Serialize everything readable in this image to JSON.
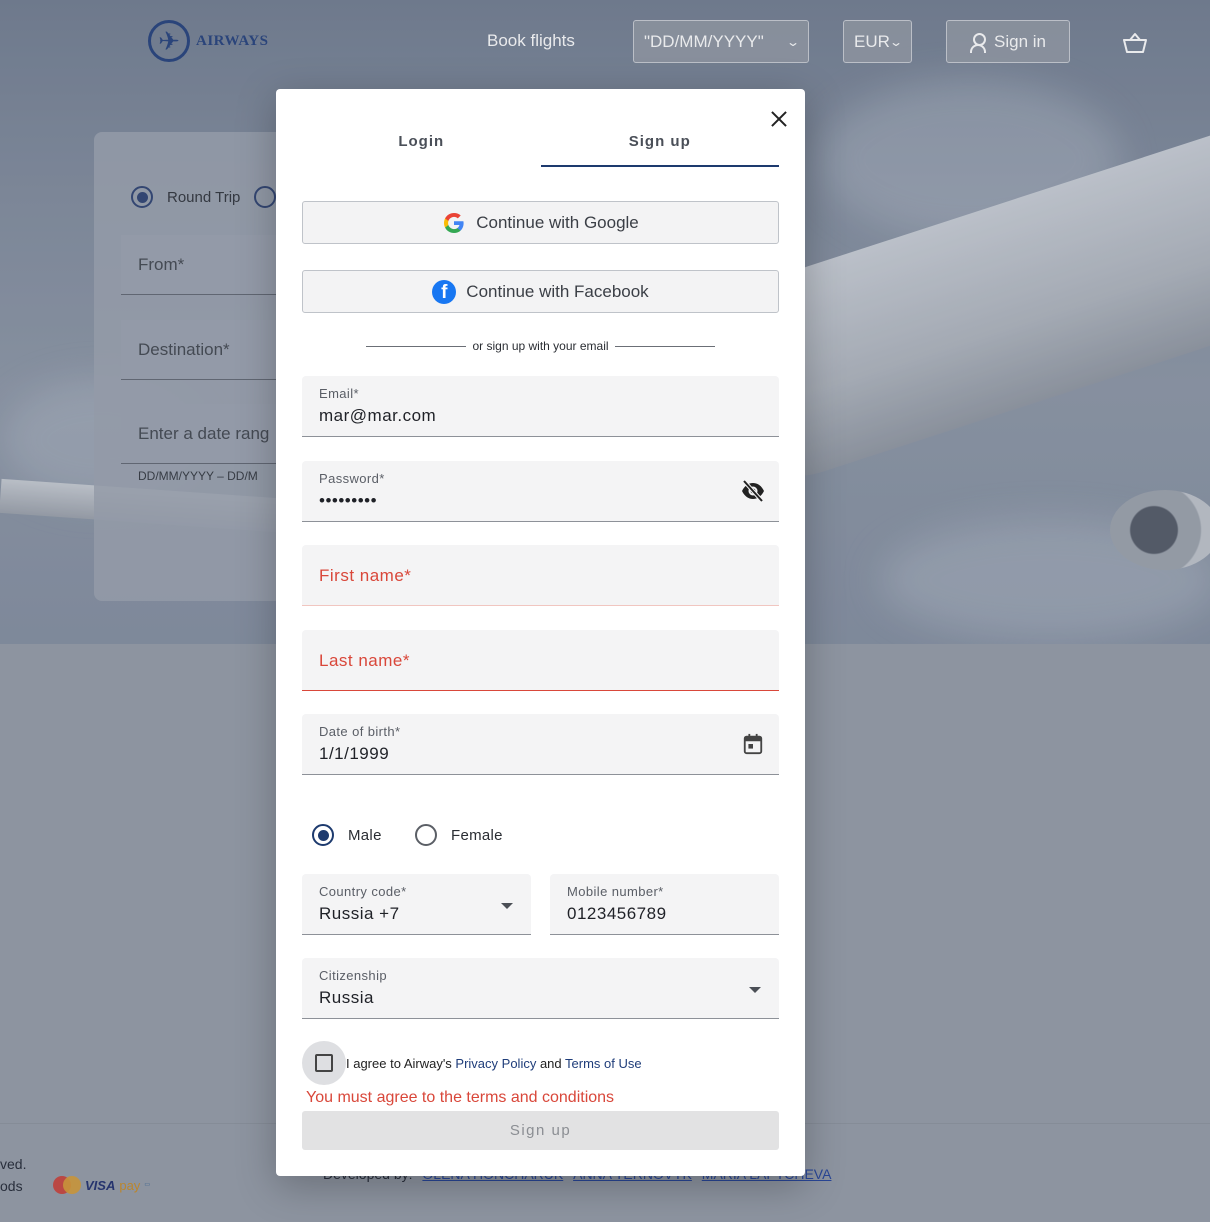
{
  "header": {
    "logo_text": "AIRWAYS",
    "nav_book": "Book flights",
    "date_format": "\"DD/MM/YYYY\"",
    "currency": "EUR",
    "sign_in": "Sign in"
  },
  "background_form": {
    "round_trip": "Round Trip",
    "from": "From*",
    "destination": "Destination*",
    "date_range": "Enter a date rang",
    "date_hint": "DD/MM/YYYY – DD/M"
  },
  "footer": {
    "rights": "ved.",
    "methods": "ods",
    "visa": "VISA",
    "pay": "pay",
    "developed_by": "Developed by:",
    "dev1": "OLENA HONCHARUK",
    "dev2": "ANNA TERNOVYK",
    "dev3": "MARIA LAPTCHEVA"
  },
  "modal": {
    "tabs": [
      "Login",
      "Sign up"
    ],
    "active_tab": "Sign up",
    "google": "Continue with Google",
    "facebook": "Continue with Facebook",
    "divider": "or sign up with your email",
    "email": {
      "label": "Email*",
      "value": "mar@mar.com"
    },
    "password": {
      "label": "Password*",
      "value": "•••••••••"
    },
    "first_name": {
      "placeholder": "First name*"
    },
    "last_name": {
      "placeholder": "Last name*"
    },
    "dob": {
      "label": "Date of birth*",
      "value": "1/1/1999"
    },
    "gender": {
      "male": "Male",
      "female": "Female",
      "selected": "Male"
    },
    "country_code": {
      "label": "Country code*",
      "value": "Russia +7"
    },
    "mobile": {
      "label": "Mobile number*",
      "value": "0123456789"
    },
    "citizenship": {
      "label": "Citizenship",
      "value": "Russia"
    },
    "agree_prefix": "I agree to Airway's ",
    "privacy": "Privacy Policy",
    "and": " and ",
    "terms": "Terms of Use",
    "agree_error": "You must agree to the terms and conditions",
    "submit": "Sign up"
  },
  "colors": {
    "accent": "#1d3a6e",
    "error": "#d9473a",
    "facebook": "#1877f2"
  }
}
